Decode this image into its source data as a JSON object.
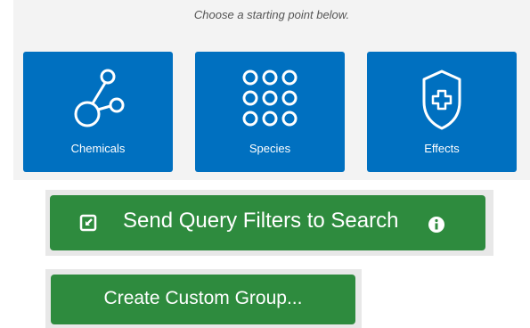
{
  "intro": {
    "hint": "Choose a starting point below."
  },
  "tiles": [
    {
      "label": "Chemicals",
      "icon": "molecule-icon"
    },
    {
      "label": "Species",
      "icon": "grid-dots-icon"
    },
    {
      "label": "Effects",
      "icon": "shield-plus-icon"
    }
  ],
  "actions": {
    "send_label": "Send Query Filters to Search",
    "send_icon": "external-link-icon",
    "info_icon": "info-icon",
    "create_label": "Create Custom Group..."
  },
  "colors": {
    "tile_blue": "#0070c0",
    "button_green": "#2e8b3e",
    "panel_bg": "#f3f3f3"
  }
}
